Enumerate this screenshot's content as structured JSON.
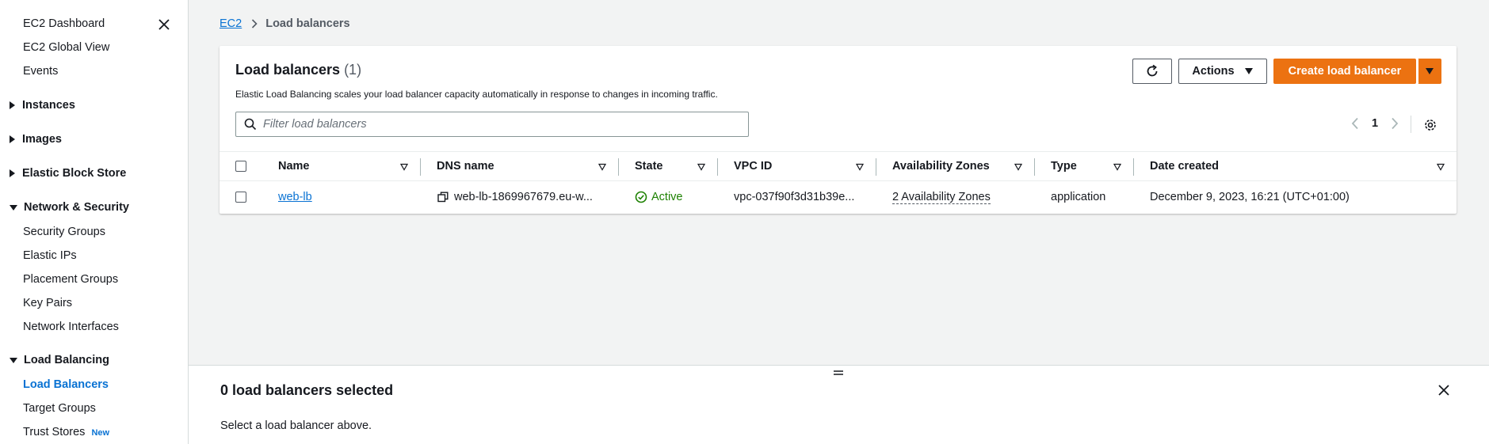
{
  "sidebar": {
    "top_links": [
      "EC2 Dashboard",
      "EC2 Global View",
      "Events"
    ],
    "sections": {
      "instances": "Instances",
      "images": "Images",
      "ebs": "Elastic Block Store",
      "network": "Network & Security",
      "lb": "Load Balancing"
    },
    "network_items": [
      "Security Groups",
      "Elastic IPs",
      "Placement Groups",
      "Key Pairs",
      "Network Interfaces"
    ],
    "lb_items": [
      "Load Balancers",
      "Target Groups",
      "Trust Stores"
    ],
    "new_badge": "New"
  },
  "breadcrumb": {
    "root": "EC2",
    "current": "Load balancers"
  },
  "panel": {
    "title": "Load balancers",
    "count": "(1)",
    "description": "Elastic Load Balancing scales your load balancer capacity automatically in response to changes in incoming traffic.",
    "actions_label": "Actions",
    "create_label": "Create load balancer",
    "search_placeholder": "Filter load balancers",
    "page": "1"
  },
  "table": {
    "columns": [
      "Name",
      "DNS name",
      "State",
      "VPC ID",
      "Availability Zones",
      "Type",
      "Date created"
    ],
    "rows": [
      {
        "name": "web-lb",
        "dns": "web-lb-1869967679.eu-w...",
        "state": "Active",
        "vpc": "vpc-037f90f3d31b39e...",
        "az": "2 Availability Zones",
        "type": "application",
        "date": "December 9, 2023, 16:21 (UTC+01:00)"
      }
    ]
  },
  "details": {
    "title": "0 load balancers selected",
    "message": "Select a load balancer above."
  },
  "colors": {
    "accent": "#0972d3",
    "primary_button": "#ec7211",
    "success": "#1d8102"
  }
}
